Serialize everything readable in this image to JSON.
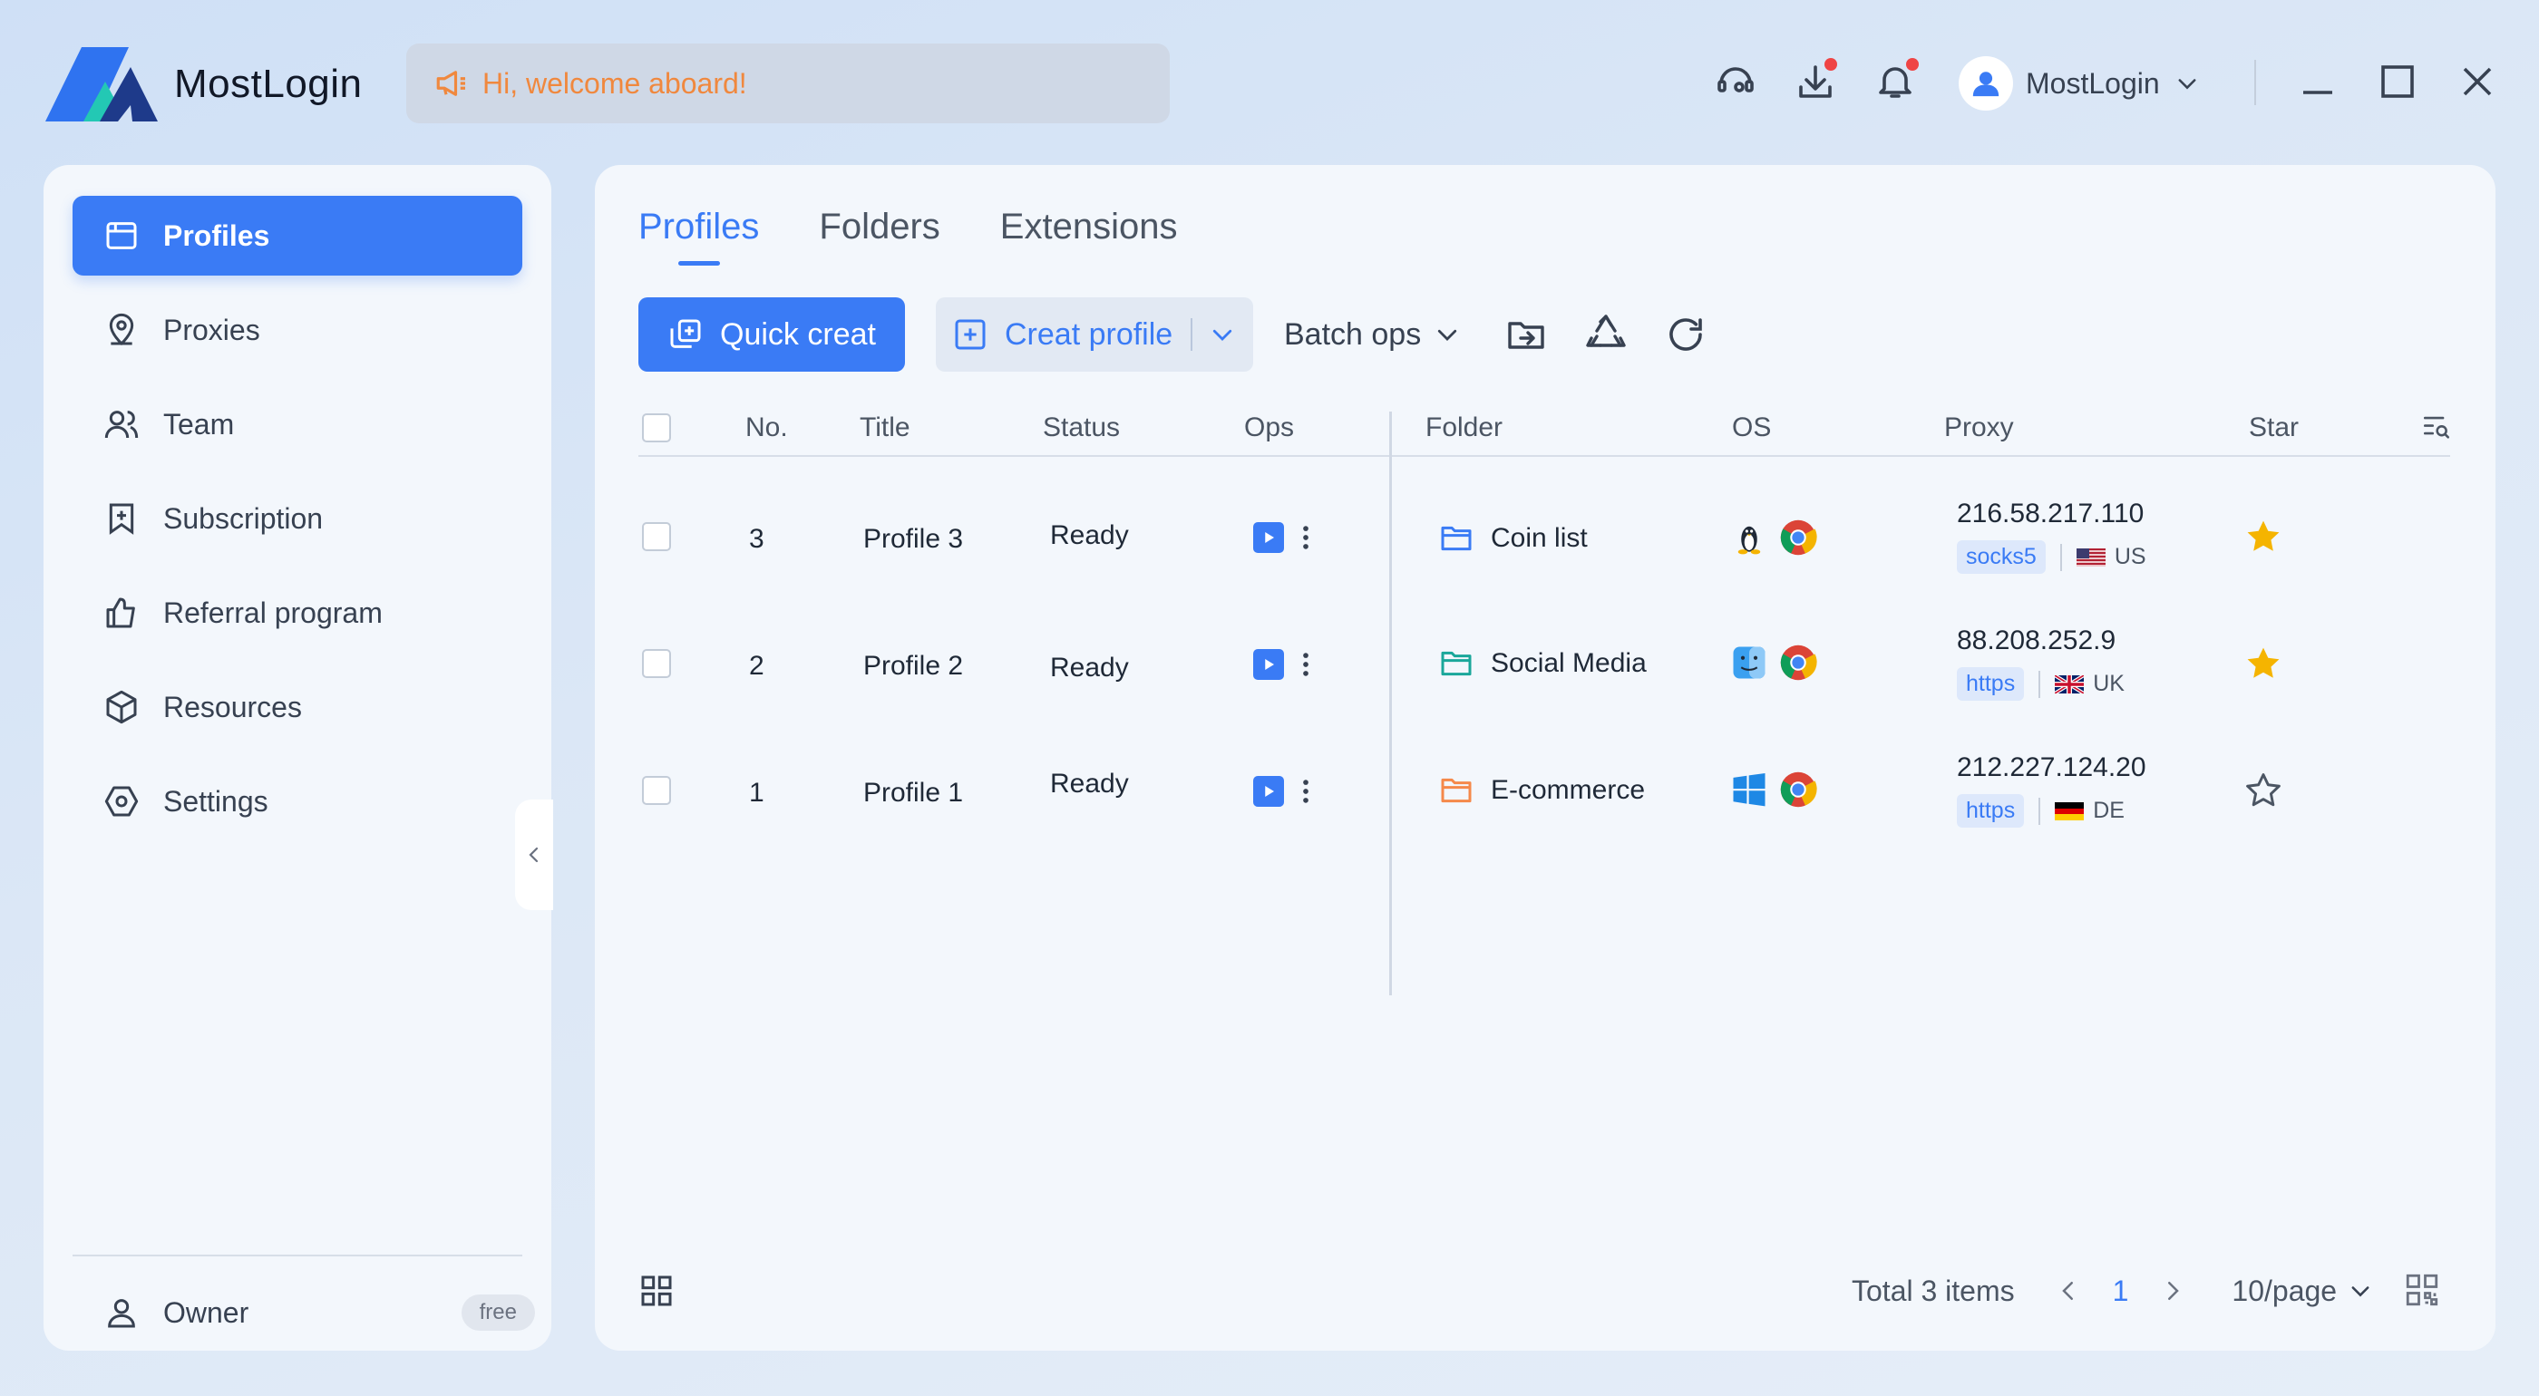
{
  "app": {
    "name": "MostLogin",
    "welcome": "Hi, welcome aboard!"
  },
  "header": {
    "icons": [
      "support-icon",
      "download-icon",
      "bell-icon"
    ],
    "user": {
      "name": "MostLogin"
    }
  },
  "sidebar": {
    "items": [
      {
        "label": "Profiles",
        "icon": "profiles-icon",
        "active": true
      },
      {
        "label": "Proxies",
        "icon": "location-pin-icon"
      },
      {
        "label": "Team",
        "icon": "team-icon"
      },
      {
        "label": "Subscription",
        "icon": "bookmark-icon"
      },
      {
        "label": "Referral program",
        "icon": "thumbs-up-icon"
      },
      {
        "label": "Resources",
        "icon": "cube-icon"
      },
      {
        "label": "Settings",
        "icon": "settings-icon"
      }
    ],
    "owner": {
      "label": "Owner",
      "plan": "free"
    }
  },
  "main": {
    "tabs": [
      {
        "label": "Profiles",
        "active": true
      },
      {
        "label": "Folders"
      },
      {
        "label": "Extensions"
      }
    ],
    "toolbar": {
      "quick_create": "Quick creat",
      "create_profile": "Creat profile",
      "batch_ops": "Batch ops"
    },
    "table": {
      "columns": [
        "No.",
        "Title",
        "Status",
        "Ops",
        "Folder",
        "OS",
        "Proxy",
        "Star"
      ],
      "rows": [
        {
          "no": "3",
          "title": "Profile 3",
          "status": "Ready",
          "folder": "Coin list",
          "folder_color": "#3a7bf5",
          "os": "linux",
          "browser": "chrome",
          "proxy_ip": "216.58.217.110",
          "proxy_type": "socks5",
          "country": "US",
          "starred": true
        },
        {
          "no": "2",
          "title": "Profile 2",
          "status": "Ready",
          "folder": "Social Media",
          "folder_color": "#1aa79a",
          "os": "macos",
          "browser": "chrome",
          "proxy_ip": "88.208.252.9",
          "proxy_type": "https",
          "country": "UK",
          "starred": true
        },
        {
          "no": "1",
          "title": "Profile 1",
          "status": "Ready",
          "folder": "E-commerce",
          "folder_color": "#f5894a",
          "os": "windows",
          "browser": "chrome",
          "proxy_ip": "212.227.124.20",
          "proxy_type": "https",
          "country": "DE",
          "starred": false
        }
      ]
    },
    "footer": {
      "total": "Total 3 items",
      "page": "1",
      "per_page": "10/page"
    }
  },
  "colors": {
    "accent": "#3a7bf5",
    "star": "#f5b400",
    "warning_text": "#f0883e"
  }
}
